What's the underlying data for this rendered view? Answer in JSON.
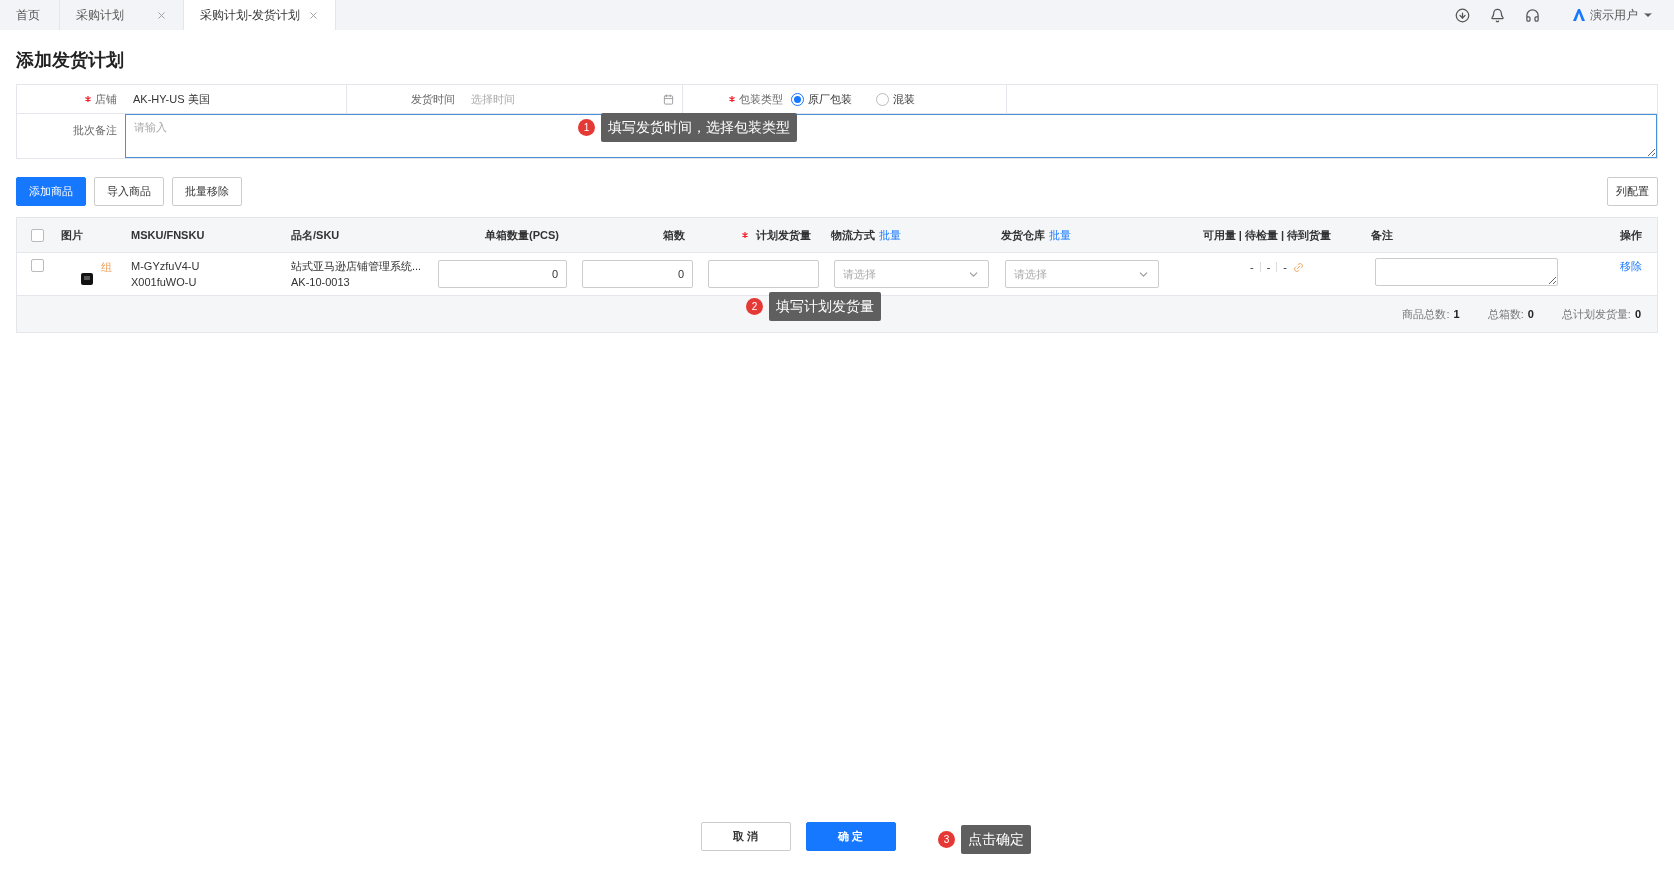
{
  "tabs": [
    {
      "label": "首页",
      "closable": false,
      "selected": false
    },
    {
      "label": "采购计划",
      "closable": true,
      "selected": false
    },
    {
      "label": "采购计划-发货计划",
      "closable": true,
      "selected": true
    }
  ],
  "user": {
    "name": "演示用户"
  },
  "page_title": "添加发货计划",
  "form": {
    "store": {
      "label": "店铺",
      "required": true,
      "value": "AK-HY-US 美国"
    },
    "ship_time": {
      "label": "发货时间",
      "required": false,
      "placeholder": "选择时间"
    },
    "packaging": {
      "label": "包装类型",
      "required": true,
      "options": [
        {
          "label": "原厂包装",
          "selected": true
        },
        {
          "label": "混装",
          "selected": false
        }
      ]
    },
    "batch_note": {
      "label": "批次备注",
      "placeholder": "请输入"
    }
  },
  "toolbar": {
    "buttons": [
      {
        "label": "添加商品",
        "kind": "primary"
      },
      {
        "label": "导入商品",
        "kind": "default"
      },
      {
        "label": "批量移除",
        "kind": "default"
      }
    ],
    "column_config": "列配置"
  },
  "table": {
    "select_all_checked": false,
    "columns": [
      {
        "label": "图片",
        "required": false
      },
      {
        "label": "MSKU/FNSKU",
        "required": false
      },
      {
        "label": "品名/SKU",
        "required": false
      },
      {
        "label": "单箱数量(PCS)",
        "required": false
      },
      {
        "label": "箱数",
        "required": false
      },
      {
        "label": "计划发货量",
        "required": true
      },
      {
        "label": "物流方式",
        "required": false,
        "link": "批量"
      },
      {
        "label": "发货仓库",
        "required": false,
        "link": "批量"
      },
      {
        "label": "可用量 | 待检量 | 待到货量",
        "required": false
      },
      {
        "label": "备注",
        "required": false
      },
      {
        "label": "操作",
        "required": false
      }
    ],
    "rows": [
      {
        "checked": false,
        "tag": "组",
        "msku": "M-GYzfuV4-U",
        "fnsku": "X001fuWO-U",
        "name": "站式亚马逊店铺管理系统...",
        "sku": "AK-10-0013",
        "unit_qty": "0",
        "boxes": "0",
        "logistics_placeholder": "请选择",
        "warehouse_placeholder": "请选择",
        "stock": [
          "-",
          "-",
          "-"
        ],
        "action": "移除"
      }
    ],
    "summary": [
      {
        "label": "商品总数:",
        "value": "1"
      },
      {
        "label": "总箱数:",
        "value": "0"
      },
      {
        "label": "总计划发货量:",
        "value": "0"
      }
    ]
  },
  "footer_buttons": [
    {
      "label": "取 消",
      "kind": "default"
    },
    {
      "label": "确 定",
      "kind": "primary"
    }
  ],
  "annotations": [
    {
      "number": "1",
      "text": "填写发货时间，选择包装类型"
    },
    {
      "number": "2",
      "text": "填写计划发货量"
    },
    {
      "number": "3",
      "text": "点击确定"
    }
  ]
}
